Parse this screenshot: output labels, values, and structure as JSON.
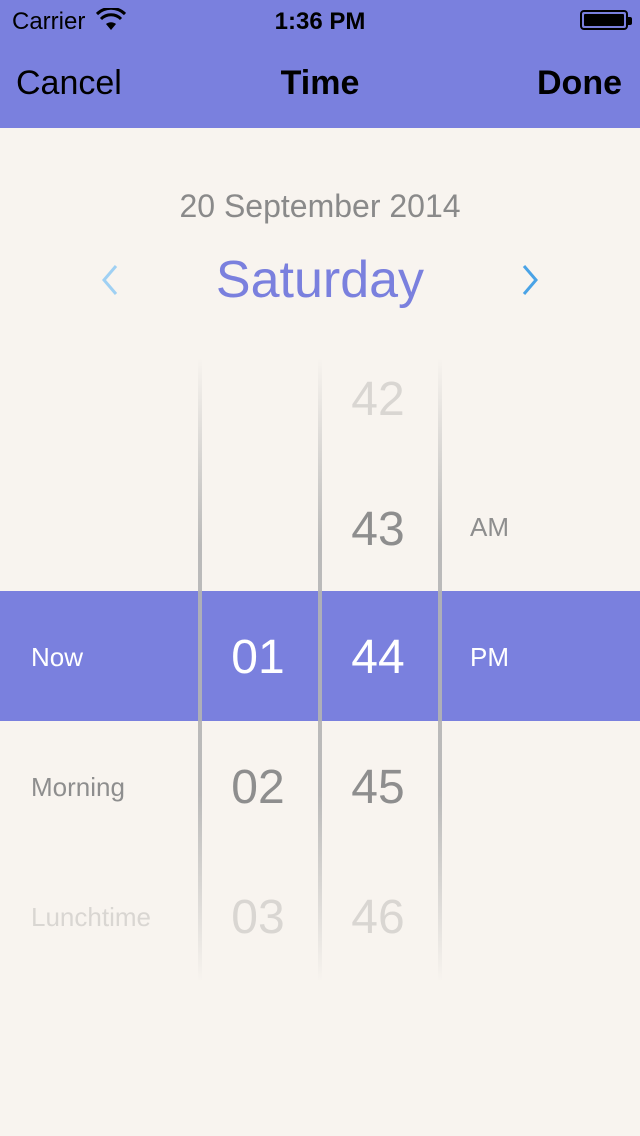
{
  "status_bar": {
    "carrier": "Carrier",
    "time": "1:36 PM"
  },
  "nav": {
    "cancel_label": "Cancel",
    "title": "Time",
    "done_label": "Done"
  },
  "date_header": {
    "date": "20 September 2014",
    "day": "Saturday"
  },
  "picker": {
    "labels": [
      "Now",
      "Morning",
      "Lunchtime"
    ],
    "hours": [
      "01",
      "02",
      "03"
    ],
    "minutes": [
      "42",
      "43",
      "44",
      "45",
      "46"
    ],
    "ampm": [
      "AM",
      "PM"
    ]
  },
  "colors": {
    "accent": "#7a80de",
    "background": "#f8f4ef",
    "chevron": "#4aa3e6"
  }
}
